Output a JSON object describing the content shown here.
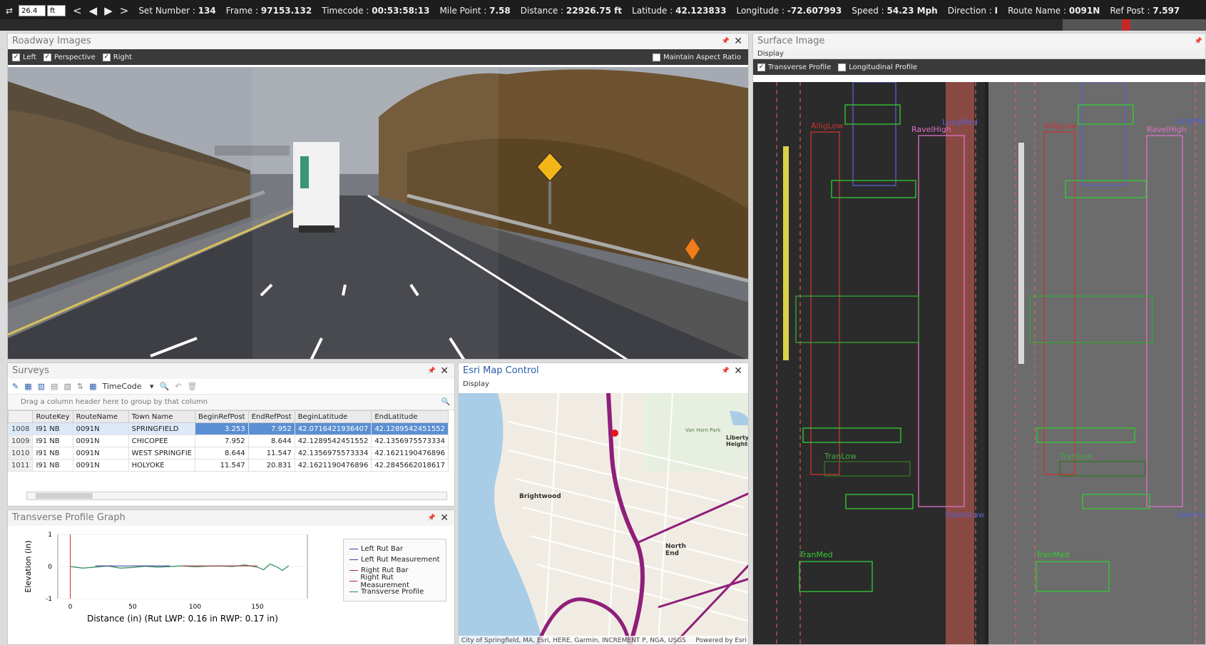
{
  "topbar": {
    "step_value": "26.4",
    "step_unit": "ft",
    "fields": [
      {
        "label": "Set Number :",
        "value": "134"
      },
      {
        "label": "Frame :",
        "value": "97153.132"
      },
      {
        "label": "Timecode :",
        "value": "00:53:58:13"
      },
      {
        "label": "Mile Point :",
        "value": "7.58"
      },
      {
        "label": "Distance :",
        "value": "22926.75 ft"
      },
      {
        "label": "Latitude :",
        "value": "42.123833"
      },
      {
        "label": "Longitude :",
        "value": "-72.607993"
      },
      {
        "label": "Speed :",
        "value": "54.23 Mph"
      },
      {
        "label": "Direction :",
        "value": "I"
      },
      {
        "label": "Route Name :",
        "value": "0091N"
      },
      {
        "label": "Ref Post :",
        "value": "7.597"
      }
    ]
  },
  "roadway": {
    "title": "Roadway Images",
    "checks": [
      {
        "label": "Left",
        "checked": true
      },
      {
        "label": "Perspective",
        "checked": true
      },
      {
        "label": "Right",
        "checked": true
      }
    ],
    "aspect_label": "Maintain Aspect Ratio"
  },
  "surface": {
    "title": "Surface Image",
    "display": "Display",
    "checks": [
      {
        "label": "Transverse Profile",
        "checked": true
      },
      {
        "label": "Longitudinal Profile",
        "checked": false
      }
    ],
    "labels": [
      "AlligLow",
      "LongMed",
      "RavelHigh",
      "TranLow",
      "TranMed",
      "AlligLow",
      "RavelHigh",
      "LongMed",
      "TranLow",
      "TranMed",
      "DeamLow",
      "DeamLow"
    ]
  },
  "surveys": {
    "title": "Surveys",
    "toolbar_combo": "TimeCode",
    "group_hint": "Drag a column header here to group by that column",
    "columns": [
      "RouteKey",
      "RouteName",
      "Town Name",
      "BeginRefPost",
      "EndRefPost",
      "BeginLatitude",
      "EndLatitude"
    ],
    "rows": [
      {
        "id": "1008",
        "cells": [
          "I91 NB",
          "0091N",
          "SPRINGFIELD",
          "3.253",
          "7.952",
          "42.0716421936407",
          "42.1289542451552"
        ]
      },
      {
        "id": "1009",
        "cells": [
          "I91 NB",
          "0091N",
          "CHICOPEE",
          "7.952",
          "8.644",
          "42.1289542451552",
          "42.1356975573334"
        ]
      },
      {
        "id": "1010",
        "cells": [
          "I91 NB",
          "0091N",
          "WEST SPRINGFIE",
          "8.644",
          "11.547",
          "42.1356975573334",
          "42.1621190476896"
        ]
      },
      {
        "id": "1011",
        "cells": [
          "I91 NB",
          "0091N",
          "HOLYOKE",
          "11.547",
          "20.831",
          "42.1621190476896",
          "42.2845662018617"
        ]
      }
    ]
  },
  "map": {
    "title": "Esri Map Control",
    "display": "Display",
    "attribution": "City of Springfield, MA, Esri, HERE, Garmin, INCREMENT P, NGA, USGS",
    "powered": "Powered by Esri",
    "places": [
      "Brightwood",
      "North End",
      "Liberty Heights",
      "Van Horn Park"
    ]
  },
  "tpg": {
    "title": "Transverse Profile Graph",
    "ylabel": "Elevation (in)",
    "xlabel": "Distance (in)  (Rut LWP: 0.16 in RWP: 0.17 in)",
    "legend": [
      {
        "name": "Left Rut Bar",
        "color": "#3a3aa0"
      },
      {
        "name": "Left Rut Measurement",
        "color": "#3a3aa0"
      },
      {
        "name": "Right Rut Bar",
        "color": "#b03030"
      },
      {
        "name": "Right Rut Measurement",
        "color": "#b03030"
      },
      {
        "name": "Transverse Profile",
        "color": "#2e8b57"
      }
    ]
  },
  "chart_data": {
    "type": "line",
    "xlabel": "Distance (in)  (Rut LWP: 0.16 in RWP: 0.17 in)",
    "ylabel": "Elevation (in)",
    "xlim": [
      -10,
      190
    ],
    "ylim": [
      -1,
      1
    ],
    "xticks": [
      0,
      50,
      100,
      150
    ],
    "yticks": [
      -1,
      0,
      1
    ],
    "series": [
      {
        "name": "Transverse Profile",
        "x": [
          0,
          10,
          20,
          30,
          40,
          50,
          60,
          70,
          80,
          90,
          100,
          110,
          120,
          130,
          140,
          150,
          155,
          160,
          165,
          170,
          175
        ],
        "y": [
          0.0,
          -0.05,
          -0.02,
          0.02,
          -0.05,
          -0.03,
          0.01,
          -0.02,
          0.0,
          0.02,
          -0.01,
          0.01,
          0.02,
          0.0,
          0.05,
          -0.02,
          -0.1,
          0.08,
          0.0,
          -0.12,
          0.02
        ]
      }
    ]
  }
}
